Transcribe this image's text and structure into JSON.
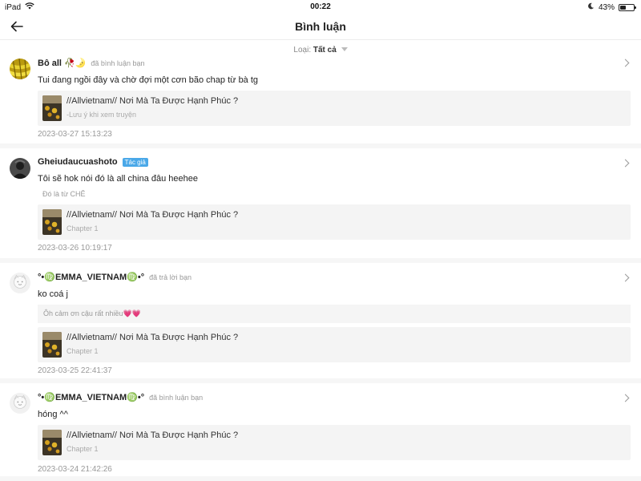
{
  "status_bar": {
    "device": "iPad",
    "time": "00:22",
    "battery_text": "43%",
    "battery_level": 0.43
  },
  "header": {
    "title": "Bình luận"
  },
  "filter": {
    "label": "Loại:",
    "value": "Tất cả"
  },
  "comments": [
    {
      "username": "Bô all 🥀🌛",
      "action": "đã bình luận bạn",
      "text": "Tui đang ngồi đây và chờ đợi một cơn bão chap từ bà tg",
      "card_title": "//Allvietnam// Nơi Mà Ta Được Hạnh Phúc ?",
      "card_sub": "-Lưu ý khi xem truyện",
      "time": "2023-03-27 15:13:23"
    },
    {
      "username": "Gheiudaucuashoto",
      "badge": "Tác giả",
      "text": "Tôi sẽ hok nói đó là all china đâu heehee",
      "quote": "Đó là từ CHÊ",
      "card_title": "//Allvietnam// Nơi Mà Ta Được Hạnh Phúc ?",
      "card_sub": "Chapter 1",
      "time": "2023-03-26 10:19:17"
    },
    {
      "username": "°•♍️EMMA_VIETNAM♍️•°",
      "action": "đã trả lời bạn",
      "text": "ko coá j",
      "quote": "Ôh cảm ơn cậu rất nhiều💗💗",
      "card_title": "//Allvietnam// Nơi Mà Ta Được Hạnh Phúc ?",
      "card_sub": "Chapter 1",
      "time": "2023-03-25 22:41:37"
    },
    {
      "username": "°•♍️EMMA_VIETNAM♍️•°",
      "action": "đã bình luận bạn",
      "text": "hóng ^^",
      "card_title": "//Allvietnam// Nơi Mà Ta Được Hạnh Phúc ?",
      "card_sub": "Chapter 1",
      "time": "2023-03-24 21:42:26"
    }
  ]
}
